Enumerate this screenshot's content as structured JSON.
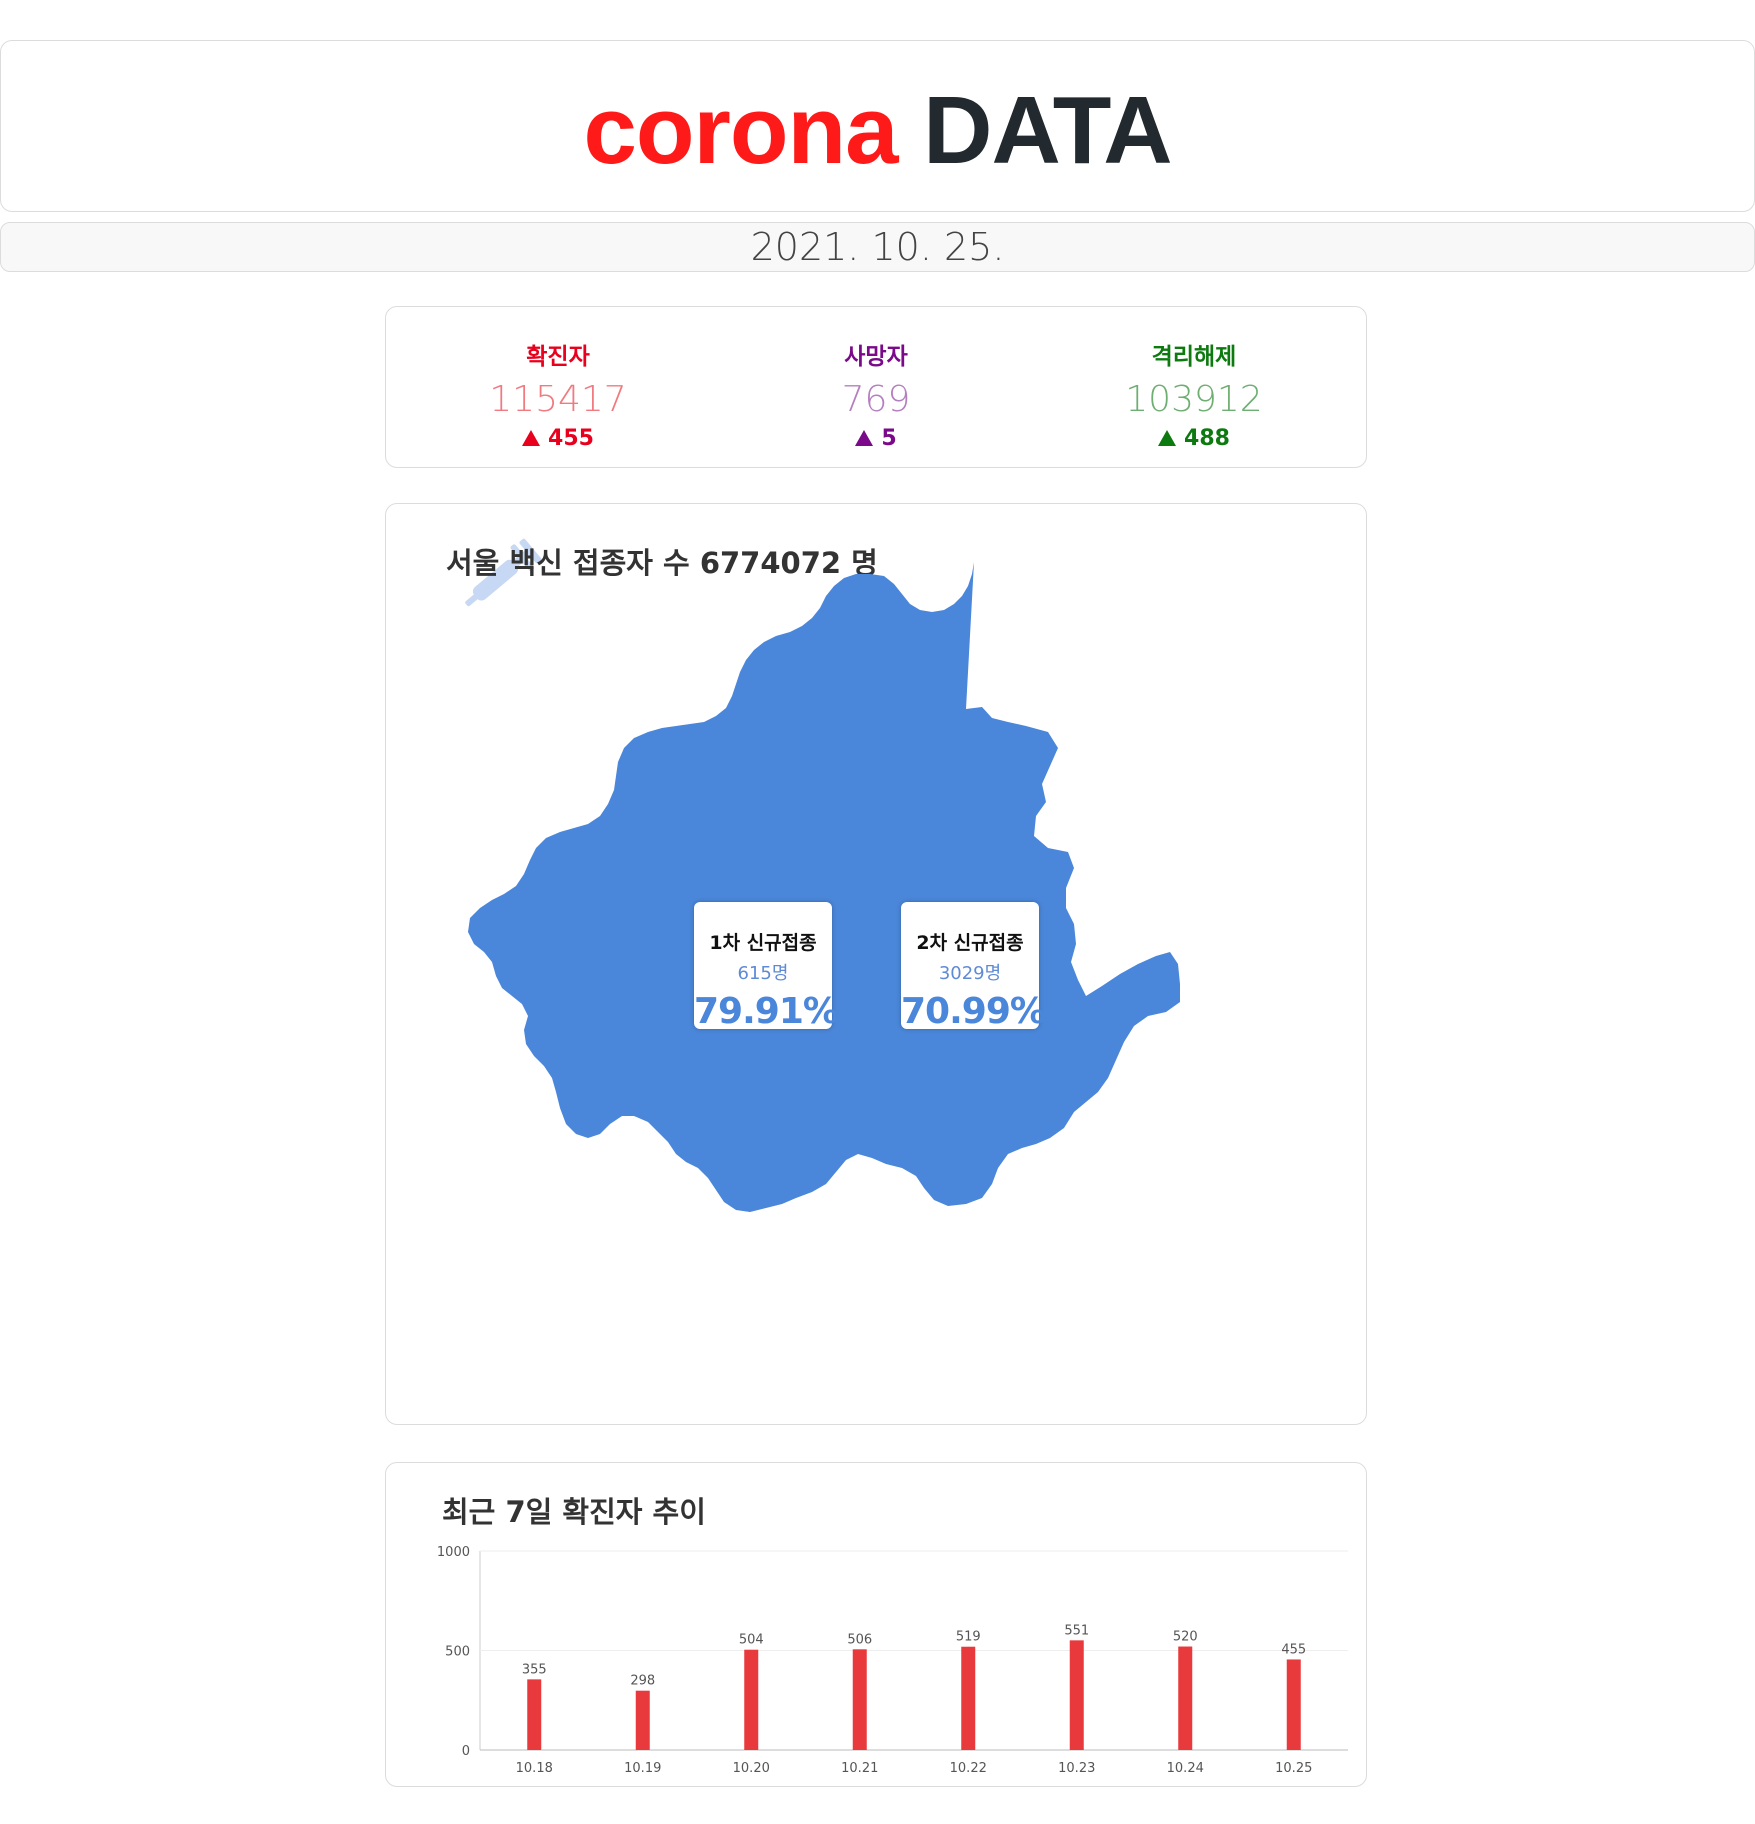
{
  "header": {
    "logo_word1": "corona",
    "logo_word2": "DATA",
    "logo_color1": "#ff1a1a",
    "logo_color2": "#222a30"
  },
  "date": "2021. 10. 25.",
  "stats": [
    {
      "label": "확진자",
      "value": "115417",
      "delta": "455",
      "color": "#e8001c",
      "value_color": "#f07a80"
    },
    {
      "label": "사망자",
      "value": "769",
      "delta": "5",
      "color": "#7a0a8a",
      "value_color": "#b47fc0"
    },
    {
      "label": "격리해제",
      "value": "103912",
      "delta": "488",
      "color": "#0d7a10",
      "value_color": "#6fae72"
    }
  ],
  "vaccine": {
    "title": "서울 백신 접종자 수 6774072 명",
    "icon": "syringe-icon",
    "map_color": "#4a86d9",
    "first": {
      "title": "1차 신규접종",
      "count": "615명",
      "percent": "79.91%"
    },
    "second": {
      "title": "2차 신규접종",
      "count": "3029명",
      "percent": "70.99%"
    }
  },
  "trend": {
    "title": "최근 7일 확진자 추이"
  },
  "chart_data": {
    "type": "bar",
    "categories": [
      "10.18",
      "10.19",
      "10.20",
      "10.21",
      "10.22",
      "10.23",
      "10.24",
      "10.25"
    ],
    "values": [
      355,
      298,
      504,
      506,
      519,
      551,
      520,
      455
    ],
    "ylim": [
      0,
      1000
    ],
    "yticks": [
      0,
      500,
      1000
    ],
    "bar_color": "#e8393c",
    "grid": true
  }
}
